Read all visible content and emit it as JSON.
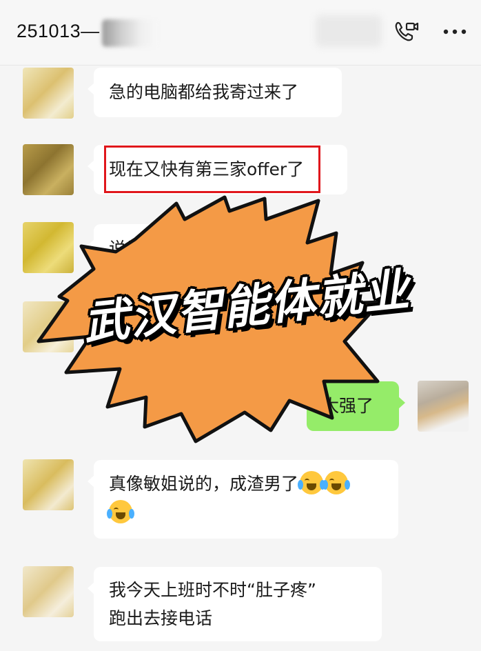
{
  "header": {
    "title": "251013—",
    "video_call_icon": "video-call-icon",
    "more_icon": "more-dots-icon"
  },
  "messages": [
    {
      "side": "in",
      "text": "急的电脑都给我寄过来了"
    },
    {
      "side": "in",
      "text": "现在又快有第三家offer了",
      "highlighted": true
    },
    {
      "side": "in",
      "text": "说是薪"
    },
    {
      "side": "out",
      "text": "太强了"
    },
    {
      "side": "in",
      "text": "真像敏姐说的，成渣男了",
      "emojis": [
        "loudly-crying-face",
        "loudly-crying-face",
        "loudly-crying-face"
      ]
    },
    {
      "side": "in",
      "line1": "我今天上班时不时“肚子疼”",
      "line2": "跑出去接电话"
    }
  ],
  "overlay": {
    "banner_text": "武汉智能体就业",
    "burst_color": "#f49a46"
  },
  "colors": {
    "incoming_bubble": "#ffffff",
    "outgoing_bubble": "#95ec69",
    "highlight_box": "#e0161b"
  }
}
